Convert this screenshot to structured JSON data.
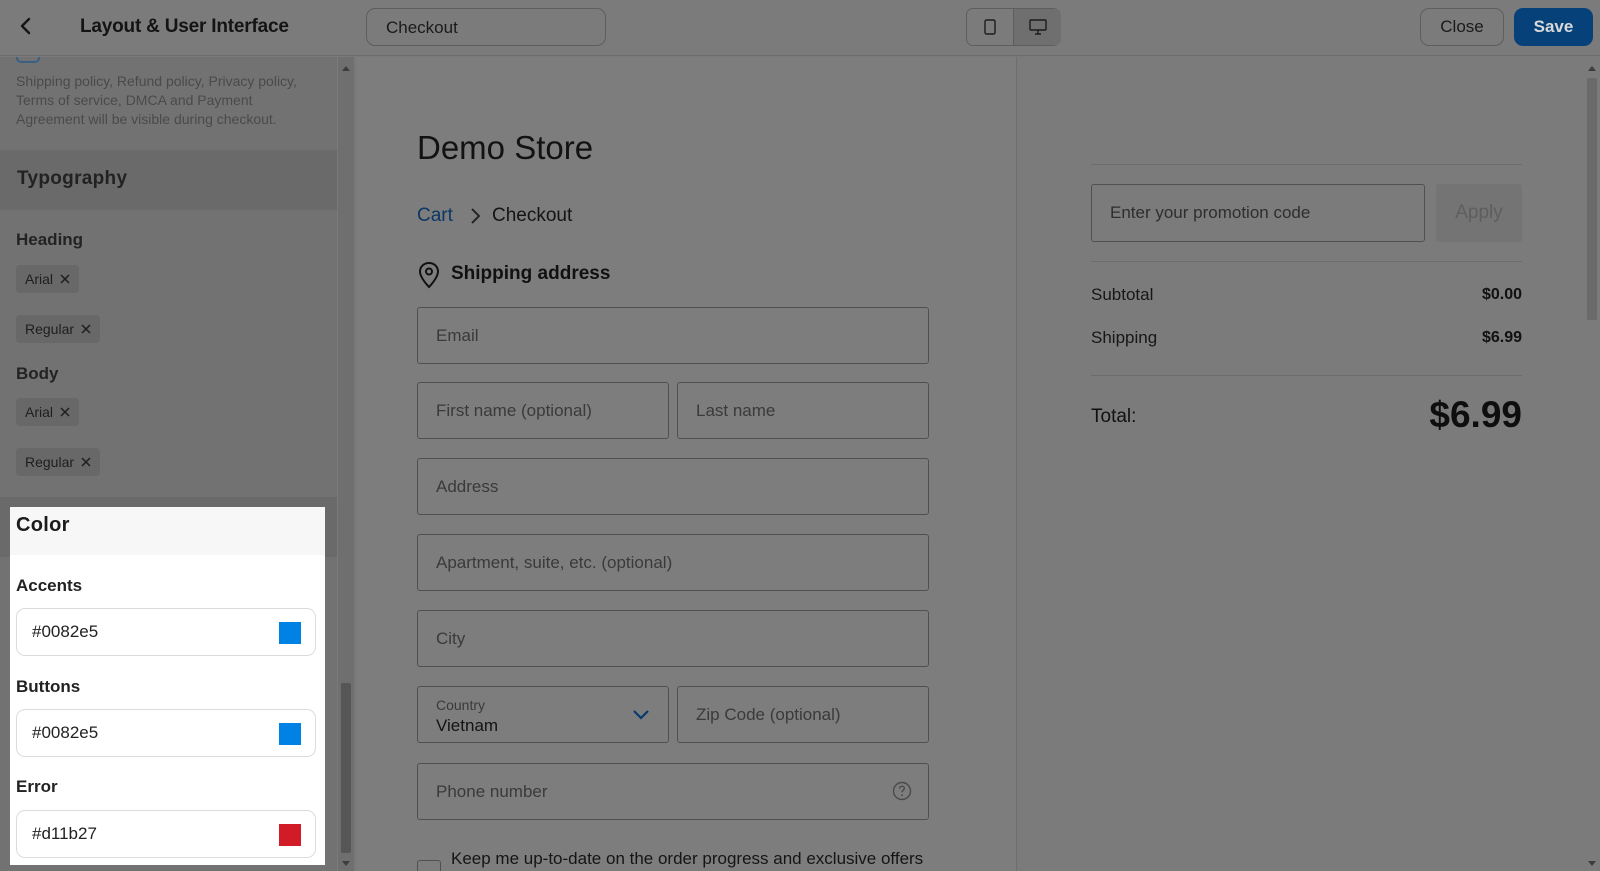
{
  "header": {
    "title": "Layout & User Interface",
    "page_select": "Checkout",
    "close_label": "Close",
    "save_label": "Save"
  },
  "sidebar": {
    "policy_note": "Shipping policy, Refund policy, Privacy policy, Terms of service, DMCA and Payment Agreement will be visible during checkout.",
    "typography": {
      "title": "Typography",
      "heading_label": "Heading",
      "heading_font": "Arial",
      "heading_weight": "Regular",
      "body_label": "Body",
      "body_font": "Arial",
      "body_weight": "Regular"
    },
    "color": {
      "title": "Color",
      "accents_label": "Accents",
      "accents_value": "#0082e5",
      "buttons_label": "Buttons",
      "buttons_value": "#0082e5",
      "error_label": "Error",
      "error_value": "#d11b27"
    }
  },
  "checkout": {
    "store_name": "Demo Store",
    "breadcrumb_cart": "Cart",
    "breadcrumb_current": "Checkout",
    "shipping_title": "Shipping address",
    "email_placeholder": "Email",
    "first_name_placeholder": "First name (optional)",
    "last_name_placeholder": "Last name",
    "address_placeholder": "Address",
    "apartment_placeholder": "Apartment, suite, etc. (optional)",
    "city_placeholder": "City",
    "country_label": "Country",
    "country_value": "Vietnam",
    "zip_placeholder": "Zip Code (optional)",
    "phone_placeholder": "Phone number",
    "keep_updated": "Keep me up-to-date on the order progress and exclusive offers"
  },
  "summary": {
    "promo_placeholder": "Enter your promotion code",
    "apply_label": "Apply",
    "subtotal_label": "Subtotal",
    "subtotal_value": "$0.00",
    "shipping_label": "Shipping",
    "shipping_value": "$6.99",
    "total_label": "Total:",
    "total_value": "$6.99"
  },
  "colors": {
    "accent": "#0082e5",
    "buttons": "#0082e5",
    "error": "#d11b27"
  }
}
